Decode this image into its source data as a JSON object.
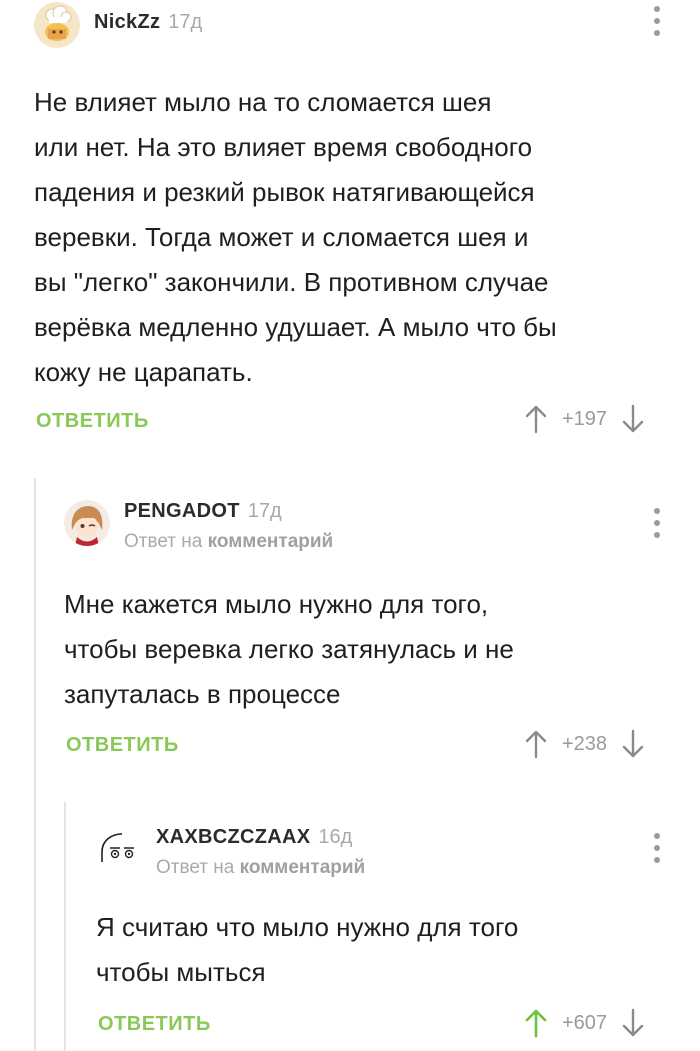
{
  "comments": [
    {
      "author": "NickZz",
      "time": "17д",
      "reply_prefix": "",
      "reply_link": "",
      "text": "Не влияет мыло на то сломается шея\nили нет. На это влияет время свободного\nпадения и резкий рывок натягивающейся\nверевки. Тогда может и сломается шея и\nвы \"легко\" закончили. В противном случае\nверёвка медленно удушает. А мыло что бы\nкожу не царапать.",
      "reply_label": "ОТВЕТИТЬ",
      "score": "+197",
      "upvoted": false
    },
    {
      "author": "PENGADOT",
      "time": "17д",
      "reply_prefix": "Ответ на ",
      "reply_link": "комментарий",
      "text": "Мне кажется мыло нужно для того,\nчтобы веревка легко затянулась и не\nзапуталась в процессе",
      "reply_label": "ОТВЕТИТЬ",
      "score": "+238",
      "upvoted": false
    },
    {
      "author": "XAXBCZCZAAX",
      "time": "16д",
      "reply_prefix": "Ответ на ",
      "reply_link": "комментарий",
      "text": "Я считаю что мыло нужно для того\nчтобы мыться",
      "reply_label": "ОТВЕТИТЬ",
      "score": "+607",
      "upvoted": true
    }
  ],
  "colors": {
    "accent_green": "#8ac858",
    "muted": "#a9a9a9"
  },
  "icons": [
    "avatar-cook",
    "avatar-anime-girl",
    "avatar-doodle-face",
    "more-vertical-icon",
    "arrow-up-icon",
    "arrow-down-icon"
  ]
}
